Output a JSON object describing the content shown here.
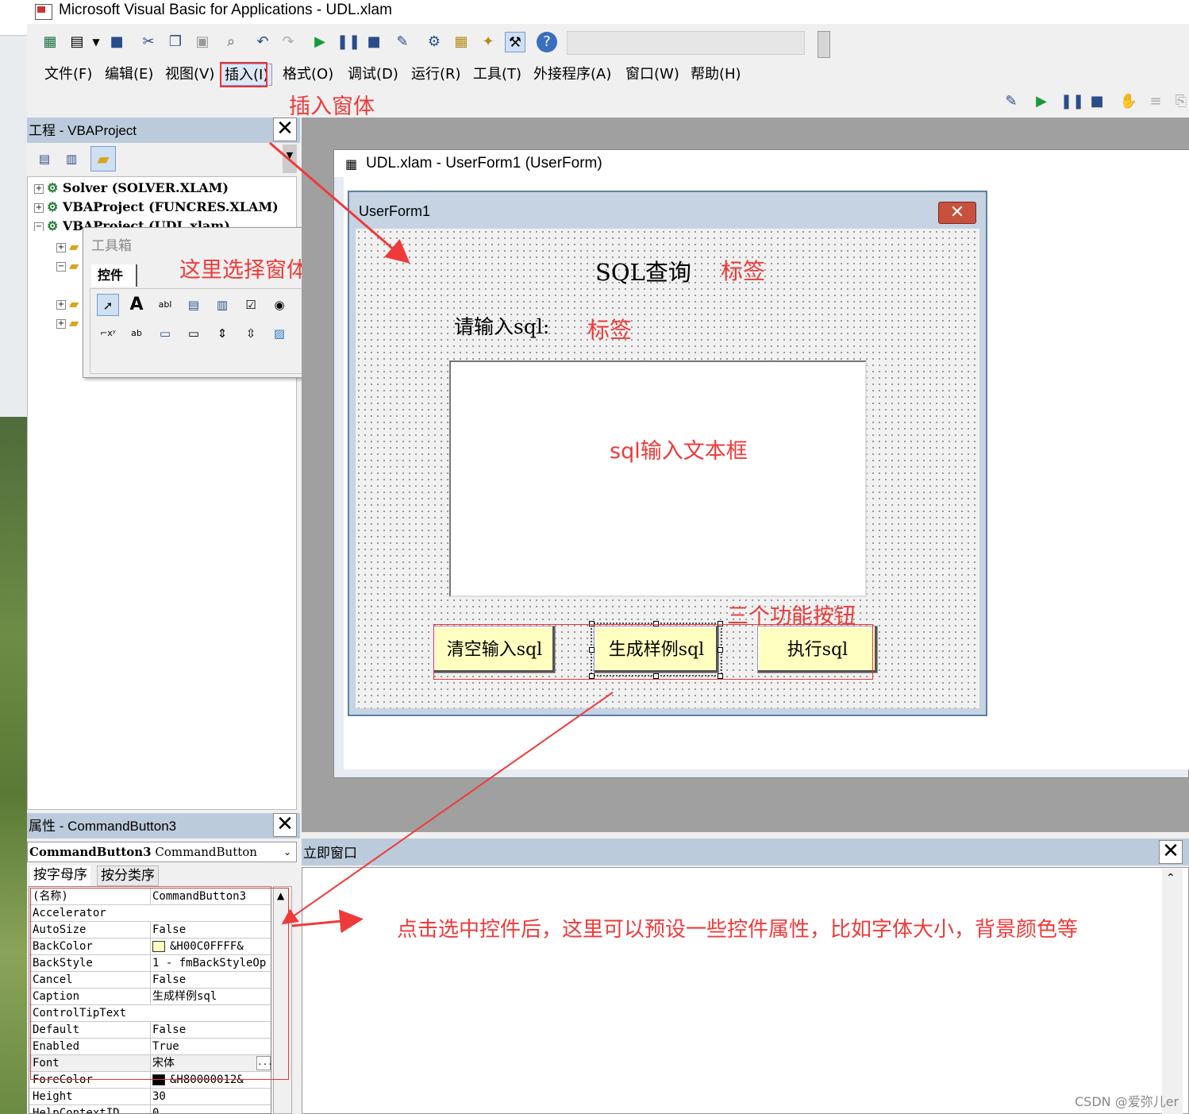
{
  "window": {
    "title": "Microsoft Visual Basic for Applications - UDL.xlam"
  },
  "menu": [
    "文件(F)",
    "编辑(E)",
    "视图(V)",
    "插入(I)",
    "格式(O)",
    "调试(D)",
    "运行(R)",
    "工具(T)",
    "外接程序(A)",
    "窗口(W)",
    "帮助(H)"
  ],
  "toolbar_icons": [
    "excel-icon",
    "userform-icon",
    "save-icon",
    "cut-icon",
    "copy-icon",
    "paste-icon",
    "find-icon",
    "undo-icon",
    "redo-icon",
    "run-icon",
    "break-icon",
    "reset-icon",
    "design-mode-icon",
    "project-explorer-icon",
    "properties-icon",
    "object-browser-icon",
    "toolbox-icon",
    "help-icon"
  ],
  "annotations": {
    "insert_form": "插入窗体",
    "toolbox_hint": "这里选择窗体控件",
    "label1": "标签",
    "label2": "标签",
    "textbox": "sql输入文本框",
    "buttons": "三个功能按钮",
    "properties_hint": "点击选中控件后，这里可以预设一些控件属性，比如字体大小，背景颜色等"
  },
  "project": {
    "title": "工程 - VBAProject",
    "items": [
      "Solver (SOLVER.XLAM)",
      "VBAProject (FUNCRES.XLAM)",
      "VBAProject (UDL.xlam)"
    ]
  },
  "toolbox": {
    "title": "工具箱",
    "tab": "控件"
  },
  "form_window": {
    "title": "UDL.xlam - UserForm1 (UserForm)"
  },
  "userform": {
    "caption": "UserForm1",
    "heading": "SQL查询",
    "prompt": "请输入sql:",
    "buttons": [
      "清空输入sql",
      "生成样例sql",
      "执行sql"
    ]
  },
  "properties": {
    "title": "属性 - CommandButton3",
    "object": "CommandButton3",
    "object_type": "CommandButton",
    "tabs": [
      "按字母序",
      "按分类序"
    ],
    "rows": [
      {
        "name": "(名称)",
        "value": "CommandButton3"
      },
      {
        "name": "Accelerator",
        "value": ""
      },
      {
        "name": "AutoSize",
        "value": "False"
      },
      {
        "name": "BackColor",
        "value": "&H00C0FFFF&"
      },
      {
        "name": "BackStyle",
        "value": "1 - fmBackStyleOp"
      },
      {
        "name": "Cancel",
        "value": "False"
      },
      {
        "name": "Caption",
        "value": "生成样例sql"
      },
      {
        "name": "ControlTipText",
        "value": ""
      },
      {
        "name": "Default",
        "value": "False"
      },
      {
        "name": "Enabled",
        "value": "True"
      },
      {
        "name": "Font",
        "value": "宋体"
      },
      {
        "name": "ForeColor",
        "value": "&H80000012&"
      },
      {
        "name": "Height",
        "value": "30"
      },
      {
        "name": "HelpContextID",
        "value": "0"
      }
    ],
    "colors": {
      "backcolor": "#ffffc0",
      "forecolor": "#000000"
    }
  },
  "immediate": {
    "title": "立即窗口"
  },
  "watermark": "CSDN @爱弥儿er",
  "colors": {
    "accent": "#ef3a3a",
    "pane_header": "#bccbdc",
    "button_face": "#ffffc0"
  }
}
